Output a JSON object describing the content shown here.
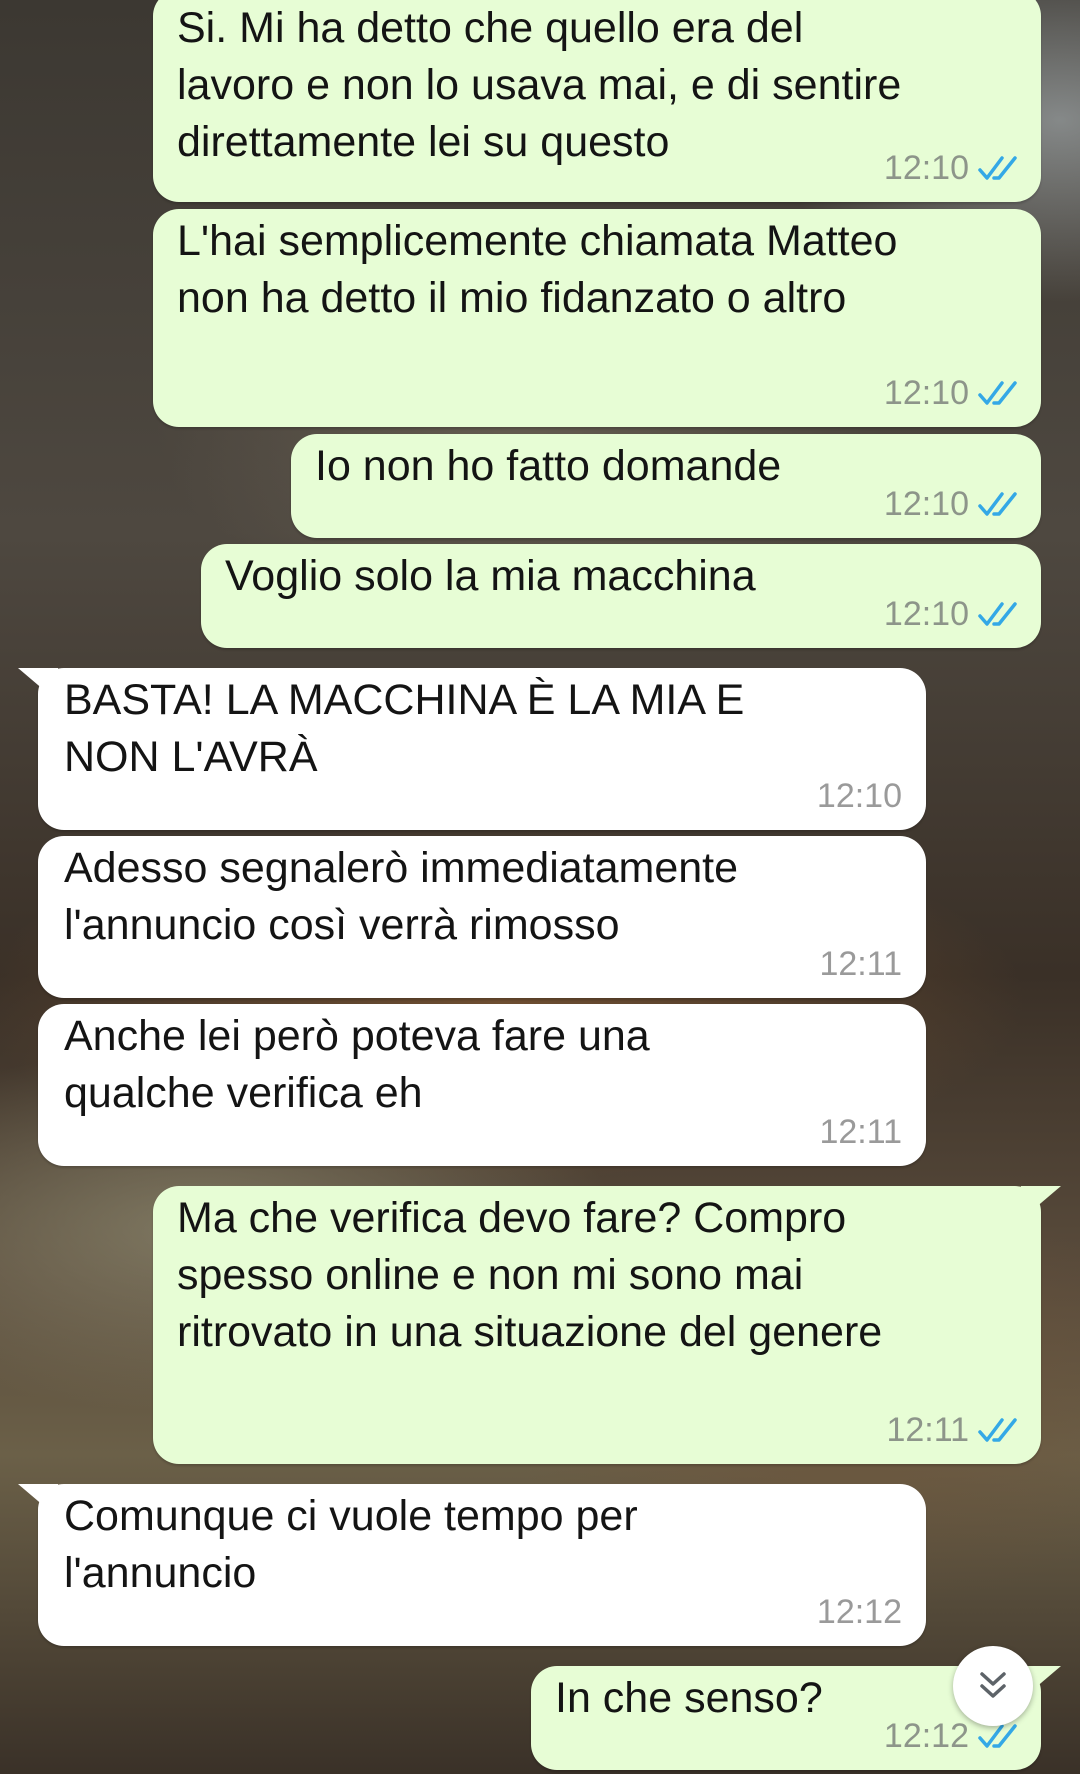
{
  "messages": [
    {
      "direction": "outgoing",
      "text": "Si. Mi ha detto che quello era del\nlavoro e non lo usava mai, e di sentire\ndirettamente lei su questo",
      "time": "12:10",
      "status": "read"
    },
    {
      "direction": "outgoing",
      "text": "L'hai semplicemente chiamata Matteo\nnon ha detto il mio fidanzato o altro",
      "time": "12:10",
      "status": "read"
    },
    {
      "direction": "outgoing",
      "text": "Io non ho fatto domande",
      "time": "12:10",
      "status": "read"
    },
    {
      "direction": "outgoing",
      "text": "Voglio solo la mia macchina",
      "time": "12:10",
      "status": "read"
    },
    {
      "direction": "incoming",
      "text": "BASTA! LA MACCHINA È LA MIA E\nNON L'AVRÀ",
      "time": "12:10"
    },
    {
      "direction": "incoming",
      "text": "Adesso segnalerò immediatamente\nl'annuncio così verrà rimosso",
      "time": "12:11"
    },
    {
      "direction": "incoming",
      "text": "Anche lei però poteva fare una\nqualche verifica eh",
      "time": "12:11"
    },
    {
      "direction": "outgoing",
      "text": "Ma che verifica devo fare? Compro\nspesso online e non mi sono mai\nritrovato in una situazione del genere",
      "time": "12:11",
      "status": "read"
    },
    {
      "direction": "incoming",
      "text": "Comunque ci vuole tempo per\nl'annuncio",
      "time": "12:12"
    },
    {
      "direction": "outgoing",
      "text": "In che senso?",
      "time": "12:12",
      "status": "read"
    }
  ],
  "colors": {
    "outgoing_bubble": "#e7fdd5",
    "incoming_bubble": "#ffffff",
    "read_ticks": "#34a8e6"
  },
  "icons": {
    "read_receipt": "double-check-icon",
    "scroll_down": "double-chevron-down-icon"
  }
}
